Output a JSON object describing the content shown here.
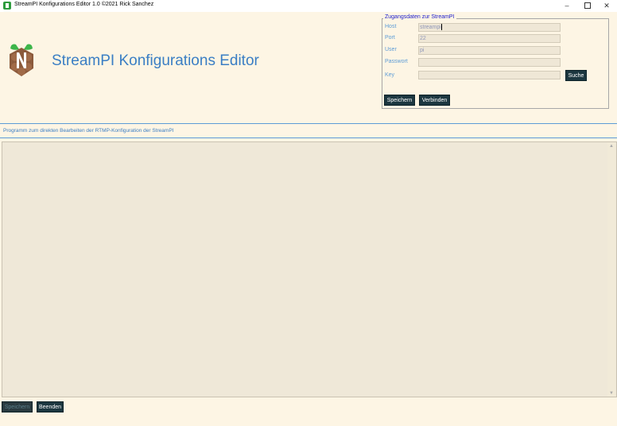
{
  "window": {
    "title": "StreamPI Konfigurations Editor 1.0 ©2021 Rick Sanchez",
    "minimize": "–",
    "close": "✕"
  },
  "header": {
    "heading": "StreamPI Konfigurations Editor"
  },
  "connection": {
    "legend": "Zugangsdaten zur StreamPI",
    "host_label": "Host",
    "host_value": "streampi",
    "port_label": "Port",
    "port_value": "22",
    "user_label": "User",
    "user_value": "pi",
    "password_label": "Passwort",
    "password_value": "",
    "key_label": "Key",
    "key_value": "",
    "search_button": "Suche",
    "save_button": "Speichern",
    "connect_button": "Verbinden"
  },
  "info_text": "Programm zum direkten Bearbeiten der RTMP-Konfiguration der StreamPI",
  "editor": {
    "content": ""
  },
  "footer": {
    "save_button": "Speichern",
    "quit_button": "Beenden"
  },
  "colors": {
    "background": "#fdf5e4",
    "accent": "#3a7ec4",
    "button": "#1c3740"
  }
}
